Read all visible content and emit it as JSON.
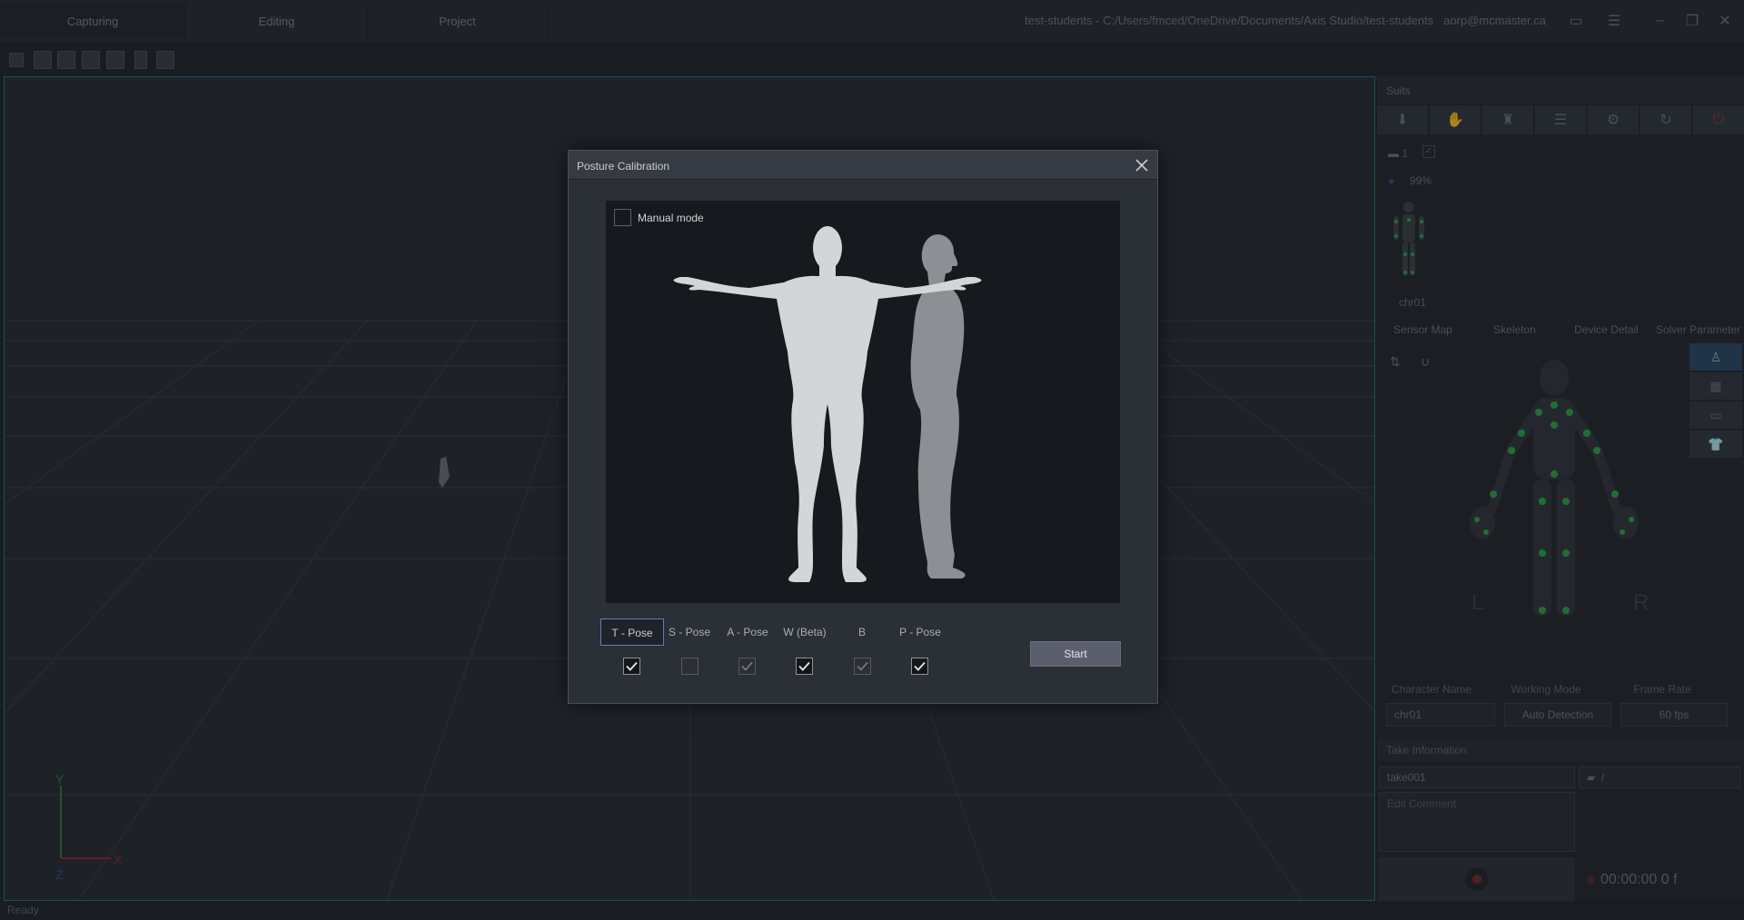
{
  "tabs": [
    {
      "label": "Capturing"
    },
    {
      "label": "Editing"
    },
    {
      "label": "Project"
    }
  ],
  "title_path": "test-students - C:/Users/fmced/OneDrive/Documents/Axis Studio/test-students",
  "user_email": "aorp@mcmaster.ca",
  "right_panel": {
    "header": "Suits",
    "battery": "99%",
    "device_count": "1",
    "character_label": "chr01",
    "subtabs": [
      "Sensor Map",
      "Skeleton",
      "Device Detail",
      "Solver Parameter"
    ],
    "side_left": "L",
    "side_right": "R",
    "fields": {
      "character_name_label": "Character Name",
      "character_name_value": "chr01",
      "working_mode_label": "Working Mode",
      "working_mode_value": "Auto Detection",
      "frame_rate_label": "Frame Rate",
      "frame_rate_value": "60 fps"
    },
    "take_information": "Take Information",
    "take_name": "take001",
    "folder_path": "/",
    "comment_placeholder": "Edit Comment",
    "timecode": "00:00:00 0 f"
  },
  "status": "Ready",
  "dialog": {
    "title": "Posture Calibration",
    "manual_mode_label": "Manual mode",
    "manual_mode_checked": false,
    "start_label": "Start",
    "poses": [
      {
        "label": "T - Pose",
        "checked": true,
        "selected": true,
        "enabled": true
      },
      {
        "label": "S - Pose",
        "checked": false,
        "selected": false,
        "enabled": true
      },
      {
        "label": "A - Pose",
        "checked": true,
        "selected": false,
        "enabled": false
      },
      {
        "label": "W (Beta)",
        "checked": true,
        "selected": false,
        "enabled": true
      },
      {
        "label": "B",
        "checked": true,
        "selected": false,
        "enabled": false
      },
      {
        "label": "P - Pose",
        "checked": true,
        "selected": false,
        "enabled": true
      }
    ]
  },
  "colors": {
    "accent": "#2b6f86",
    "selected_border": "#5a7fb5",
    "sensor_green": "#2fa34a",
    "record_red": "#7a2b2b"
  }
}
